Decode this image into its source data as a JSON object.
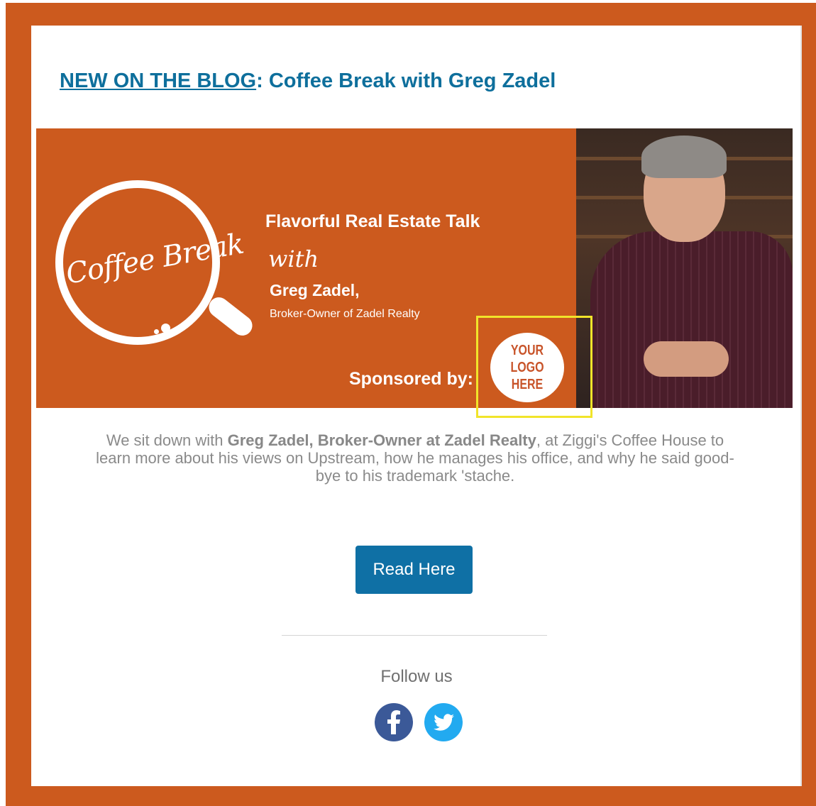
{
  "headline": {
    "link_text": "NEW ON THE BLOG",
    "separator": ":",
    "title": " Coffee Break with Greg Zadel"
  },
  "banner": {
    "cup_text": "Coffee Break",
    "title": "Flavorful Real Estate Talk",
    "with": "with",
    "name": "Greg Zadel,",
    "role": "Broker-Owner of Zadel Realty",
    "sponsored": "Sponsored by:",
    "logo_text": "YOUR\nLOGO\nHERE",
    "highlight_color": "#f1e42a"
  },
  "description": {
    "intro": "We sit down with ",
    "bold": "Greg Zadel, Broker-Owner at Zadel Realty",
    "rest": ", at Ziggi's Coffee House to learn more about his views on Upstream, how he manages his office, and why he said good-bye to his trademark 'stache."
  },
  "button": {
    "label": "Read Here"
  },
  "footer": {
    "follow": "Follow us",
    "icons": [
      "facebook-icon",
      "twitter-icon"
    ]
  },
  "colors": {
    "brand_orange": "#cc5a1e",
    "link_blue": "#0e6f9c",
    "button_blue": "#0f70a5",
    "facebook": "#3b5998",
    "twitter": "#22aaf0"
  }
}
